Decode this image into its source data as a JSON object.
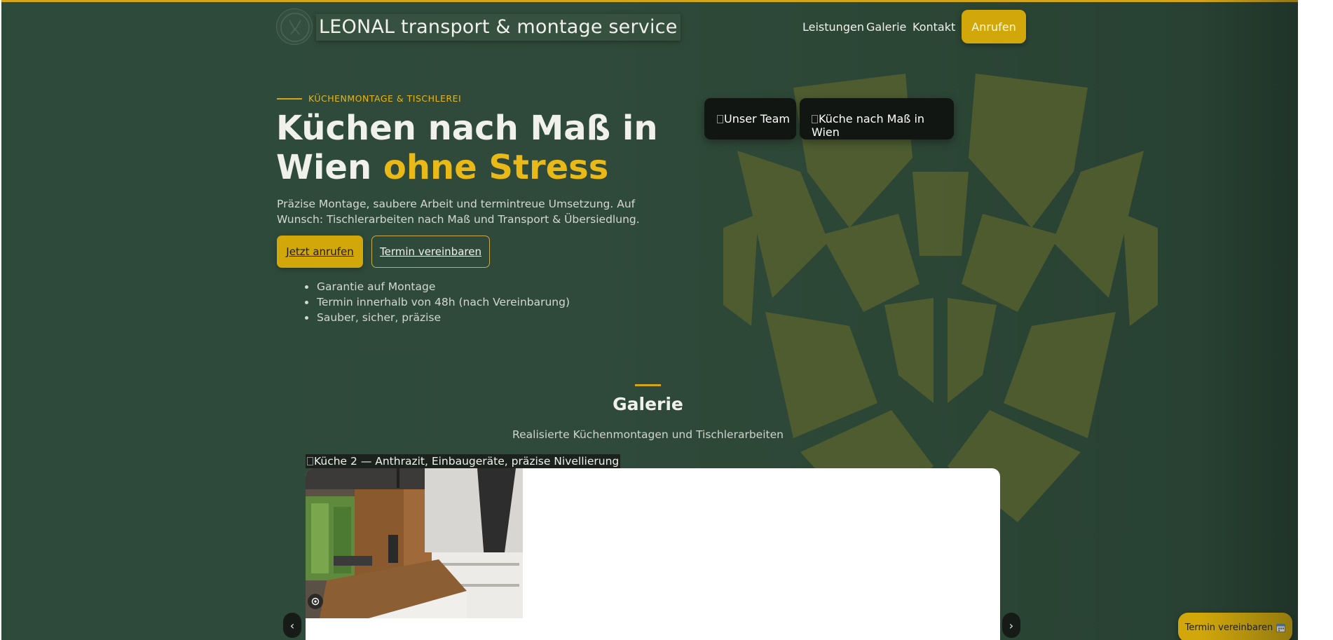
{
  "header": {
    "brand": "LEONAL transport & montage service",
    "nav": [
      "Leistungen",
      "Galerie",
      "Kontakt"
    ],
    "call_button": "Anrufen"
  },
  "hero": {
    "eyebrow": "KÜCHENMONTAGE & TISCHLEREI",
    "headline_main": "Küchen nach Maß in Wien ",
    "headline_accent": "ohne Stress",
    "lead": "Präzise Montage, saubere Arbeit und termintreue Umsetzung. Auf Wunsch: Tischlerarbeiten nach Maß und Transport & Übersiedlung.",
    "primary_button": "Jetzt anrufen",
    "secondary_button": "Termin vereinbaren",
    "bullets": [
      "Garantie auf Montage",
      "Termin innerhalb von 48h (nach Vereinbarung)",
      "Sauber, sicher, präzise"
    ],
    "image_alts": [
      "Unser Team",
      "Küche nach Maß in Wien"
    ]
  },
  "gallery": {
    "title": "Galerie",
    "subtitle": "Realisierte Küchenmontagen und Tischlerarbeiten",
    "caption": "Küche 2 — Anthrazit, Einbaugeräte, präzise Nivellierung",
    "prev_label": "‹",
    "next_label": "›"
  },
  "floating_cta": {
    "label": "Termin vereinbaren"
  },
  "colors": {
    "background": "#2e4a3a",
    "accent": "#d4a514",
    "text": "#f1f1ec"
  }
}
